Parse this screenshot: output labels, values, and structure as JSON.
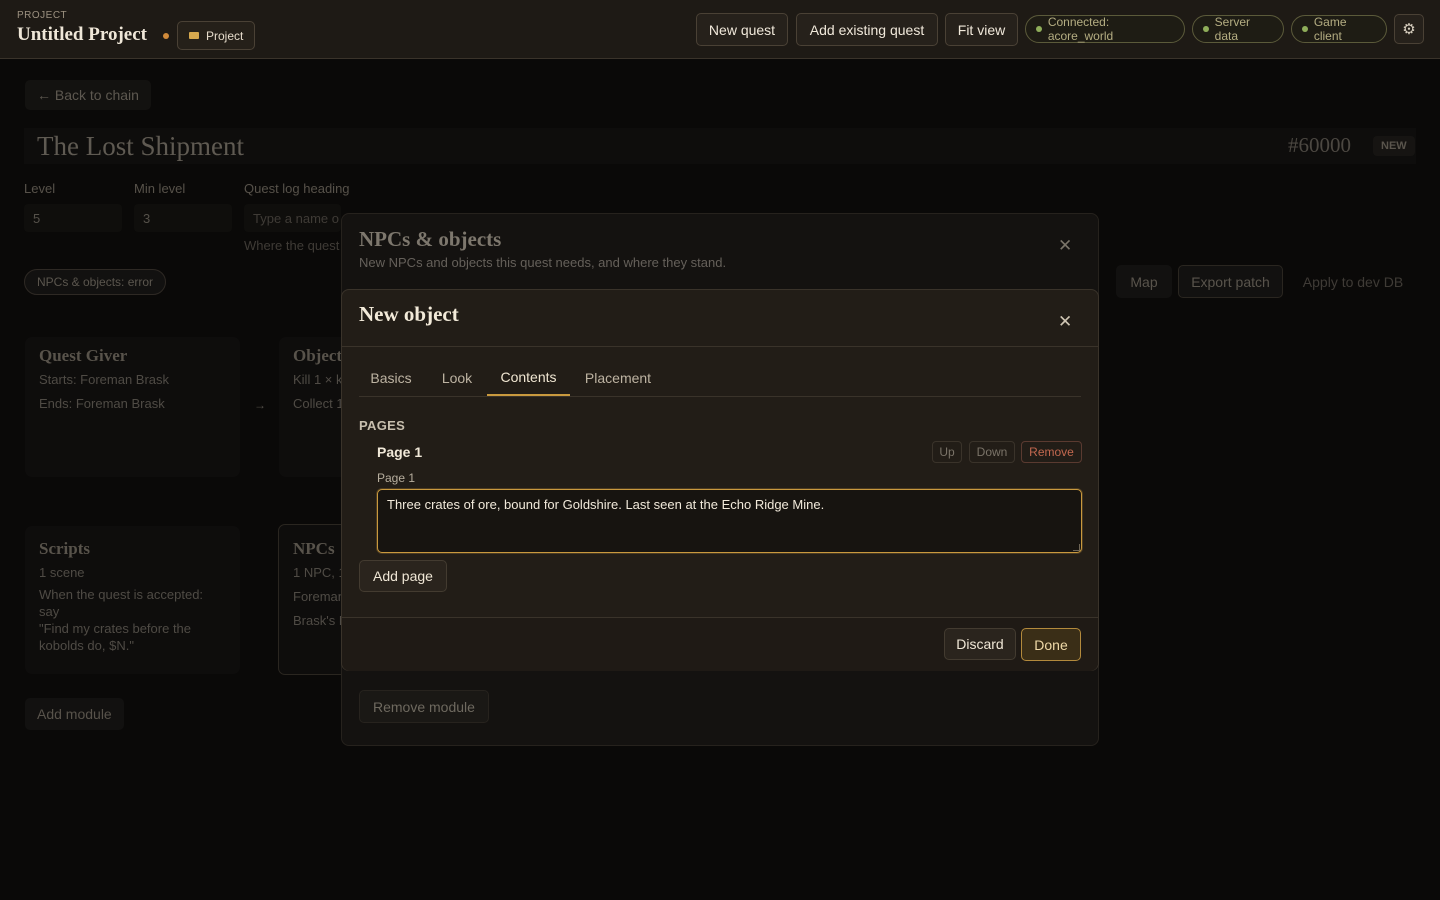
{
  "header": {
    "project_caption": "PROJECT",
    "project_name": "Untitled Project",
    "project_chip": "Project",
    "buttons": [
      "New quest",
      "Add existing quest",
      "Fit view"
    ],
    "status": [
      "Connected: acore_world",
      "Server data",
      "Game client"
    ],
    "settings_icon": "gear-icon",
    "unsaved_color": "#d08a3a",
    "status_color": "#8fae5a"
  },
  "page": {
    "back_label": "← Back to chain",
    "quest_title": "The Lost Shipment",
    "quest_id": "#60000",
    "new_tag": "NEW",
    "fields": {
      "level_label": "Level",
      "level_value": "5",
      "min_level_label": "Min level",
      "min_level_value": "3",
      "log_heading_label": "Quest log heading",
      "log_heading_placeholder": "Type a name o",
      "log_heading_hint": "Where the quest"
    },
    "error_chip": "NPCs & objects: error",
    "right_buttons": [
      "Map",
      "Export patch",
      "Apply to dev DB"
    ],
    "cards": {
      "giver_title": "Quest Giver",
      "giver_lines": [
        "Starts: Foreman Brask",
        "Ends: Foreman Brask"
      ],
      "objectives_title": "Object",
      "objectives_lines": [
        "Kill 1 × k",
        "Collect 1"
      ],
      "scripts_title": "Scripts",
      "scripts_lines": [
        "1 scene",
        "When the quest is accepted: say",
        "\"Find my crates before the",
        "kobolds do, $N.\""
      ],
      "npcs_title": "NPCs",
      "npcs_lines": [
        "1 NPC, 1",
        "Foreman",
        "Brask's L"
      ]
    },
    "add_module": "Add module"
  },
  "outer_dialog": {
    "title": "NPCs & objects",
    "subtitle": "New NPCs and objects this quest needs, and where they stand.",
    "remove_module": "Remove module"
  },
  "inner_dialog": {
    "title": "New object",
    "tabs": [
      "Basics",
      "Look",
      "Contents",
      "Placement"
    ],
    "active_tab": "Contents",
    "section_title": "PAGES",
    "page_heading": "Page 1",
    "page_label": "Page 1",
    "page_text": "Three crates of ore, bound for Goldshire. Last seen at the Echo Ridge Mine.",
    "move_up": "Up",
    "move_down": "Down",
    "remove": "Remove",
    "add_page": "Add page",
    "discard": "Discard",
    "done": "Done"
  },
  "colors": {
    "accent": "#c9993e",
    "background": "#0a0908",
    "danger": "#c2684f"
  }
}
